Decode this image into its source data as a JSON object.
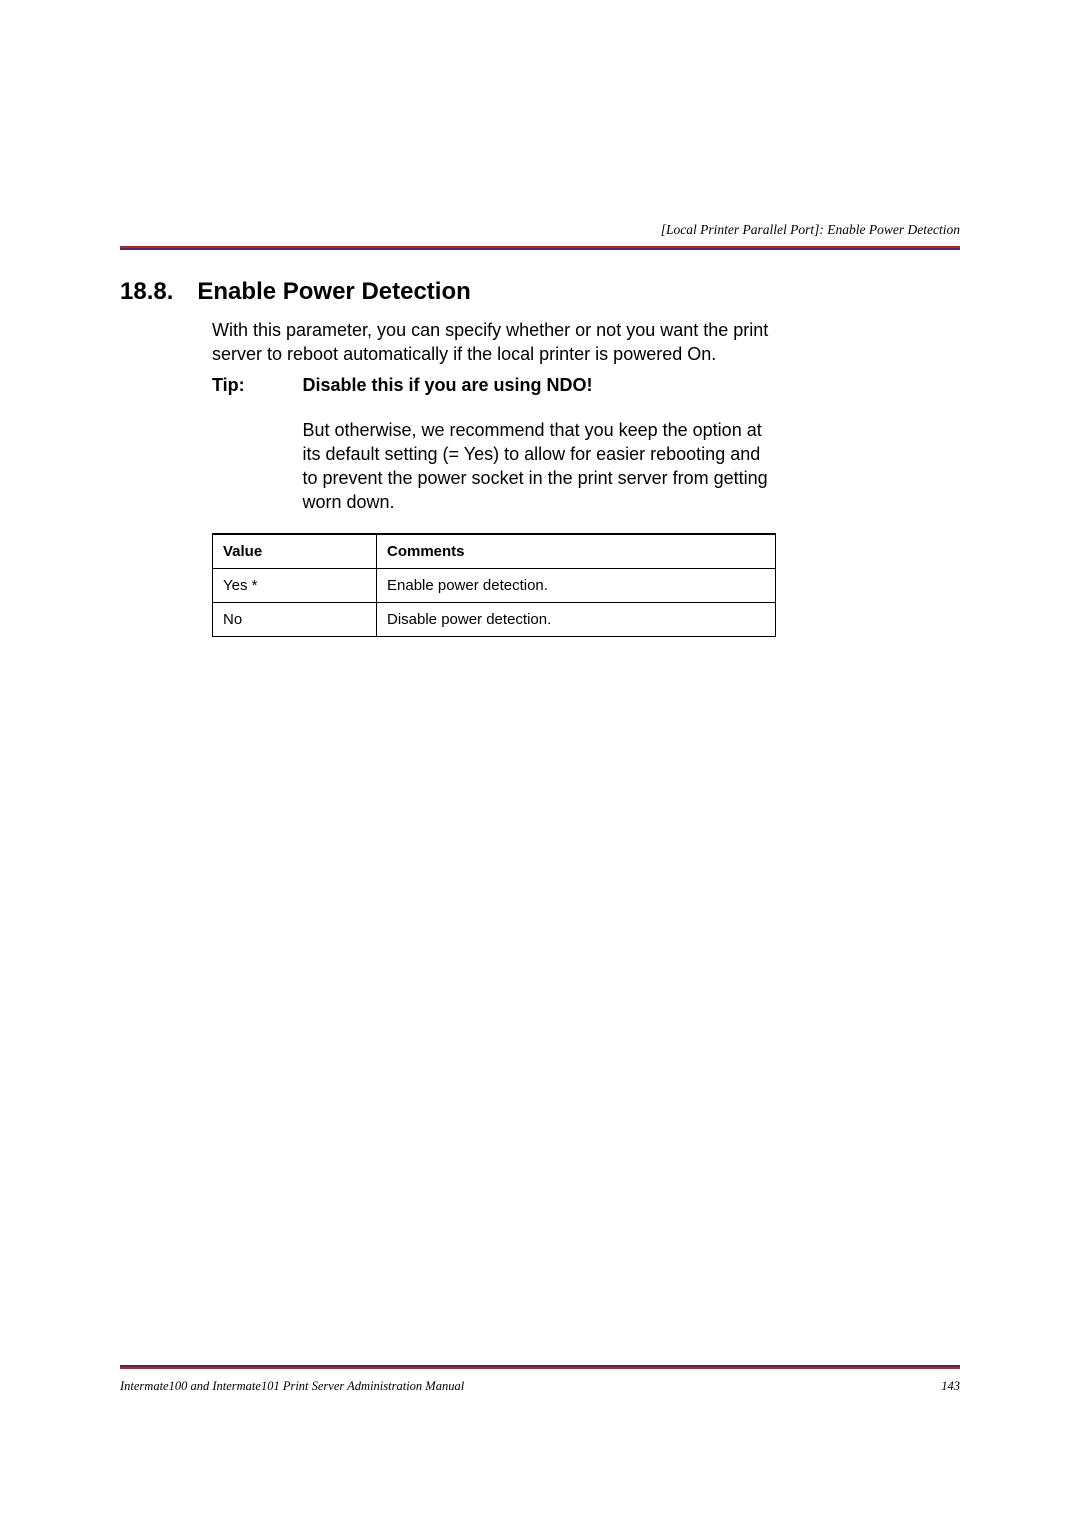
{
  "header": {
    "breadcrumb": "[Local Printer Parallel Port]: Enable Power Detection"
  },
  "section": {
    "number": "18.8.",
    "title": "Enable Power Detection",
    "intro": "With this parameter, you can specify whether or not you want the print server to reboot automatically if the local printer is powered On."
  },
  "tip": {
    "label": "Tip:",
    "strong": "Disable this if you are using NDO",
    "strong_suffix": "!",
    "para": "But otherwise, we recommend that you keep the option at its default setting (= Yes) to allow for easier rebooting and to prevent the power socket in the print server from getting worn down."
  },
  "table": {
    "headers": {
      "value": "Value",
      "comments": "Comments"
    },
    "rows": [
      {
        "value": "Yes *",
        "comments": "Enable power detection."
      },
      {
        "value": "No",
        "comments": "Disable power detection."
      }
    ]
  },
  "footer": {
    "manual": "Intermate100 and Intermate101 Print Server Administration Manual",
    "page": "143"
  }
}
